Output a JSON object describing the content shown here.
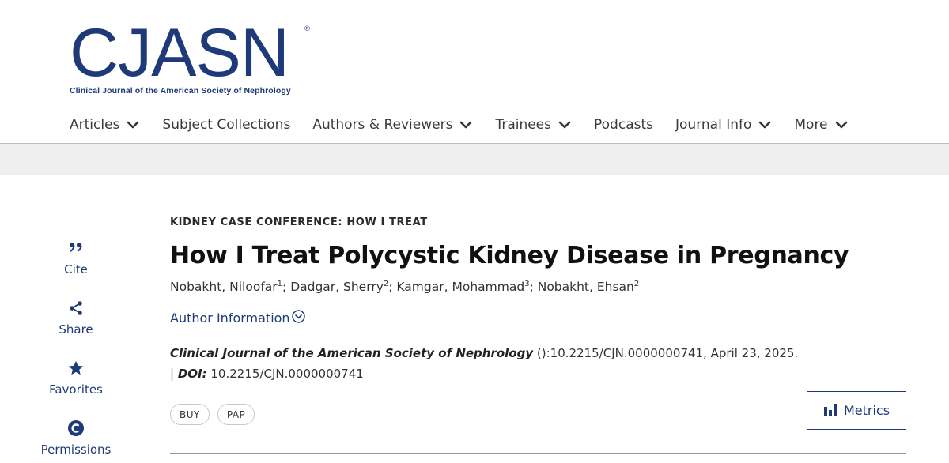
{
  "logo": {
    "main": "CJASN",
    "registered": "®",
    "subtitle": "Clinical Journal of the American Society of Nephrology"
  },
  "nav": {
    "items": [
      {
        "label": "Articles",
        "has_dropdown": true
      },
      {
        "label": "Subject Collections",
        "has_dropdown": false
      },
      {
        "label": "Authors & Reviewers",
        "has_dropdown": true
      },
      {
        "label": "Trainees",
        "has_dropdown": true
      },
      {
        "label": "Podcasts",
        "has_dropdown": false
      },
      {
        "label": "Journal Info",
        "has_dropdown": true
      },
      {
        "label": "More",
        "has_dropdown": true
      }
    ]
  },
  "sidebar_tools": {
    "cite": {
      "label": "Cite",
      "icon": "quote-icon"
    },
    "share": {
      "label": "Share",
      "icon": "share-icon"
    },
    "favorites": {
      "label": "Favorites",
      "icon": "star-icon"
    },
    "permissions": {
      "label": "Permissions",
      "icon": "copyright-icon"
    }
  },
  "article": {
    "kicker": "KIDNEY CASE CONFERENCE: HOW I TREAT",
    "title": "How I Treat Polycystic Kidney Disease in Pregnancy",
    "authors": [
      {
        "name": "Nobakht, Niloofar",
        "sup": "1"
      },
      {
        "name": "Dadgar, Sherry",
        "sup": "2"
      },
      {
        "name": "Kamgar, Mohammad",
        "sup": "3"
      },
      {
        "name": "Nobakht, Ehsan",
        "sup": "2"
      }
    ],
    "author_info_label": "Author Information",
    "citation": {
      "journal": "Clinical Journal of the American Society of Nephrology",
      "details": " ():10.2215/CJN.0000000741, April 23, 2025. | ",
      "doi_label": "DOI:",
      "doi_value": " 10.2215/CJN.0000000741"
    },
    "badges": [
      "BUY",
      "PAP"
    ]
  },
  "metrics_button": {
    "label": "Metrics",
    "icon": "bar-chart-icon"
  },
  "colors": {
    "brand": "#1e3a78",
    "graybar": "#efefef",
    "text": "#333333"
  }
}
